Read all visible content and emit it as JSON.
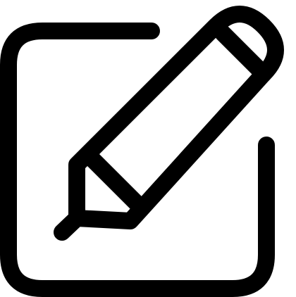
{
  "icon": {
    "name": "edit-icon",
    "stroke_color": "#000000",
    "background_color": "#ffffff"
  }
}
